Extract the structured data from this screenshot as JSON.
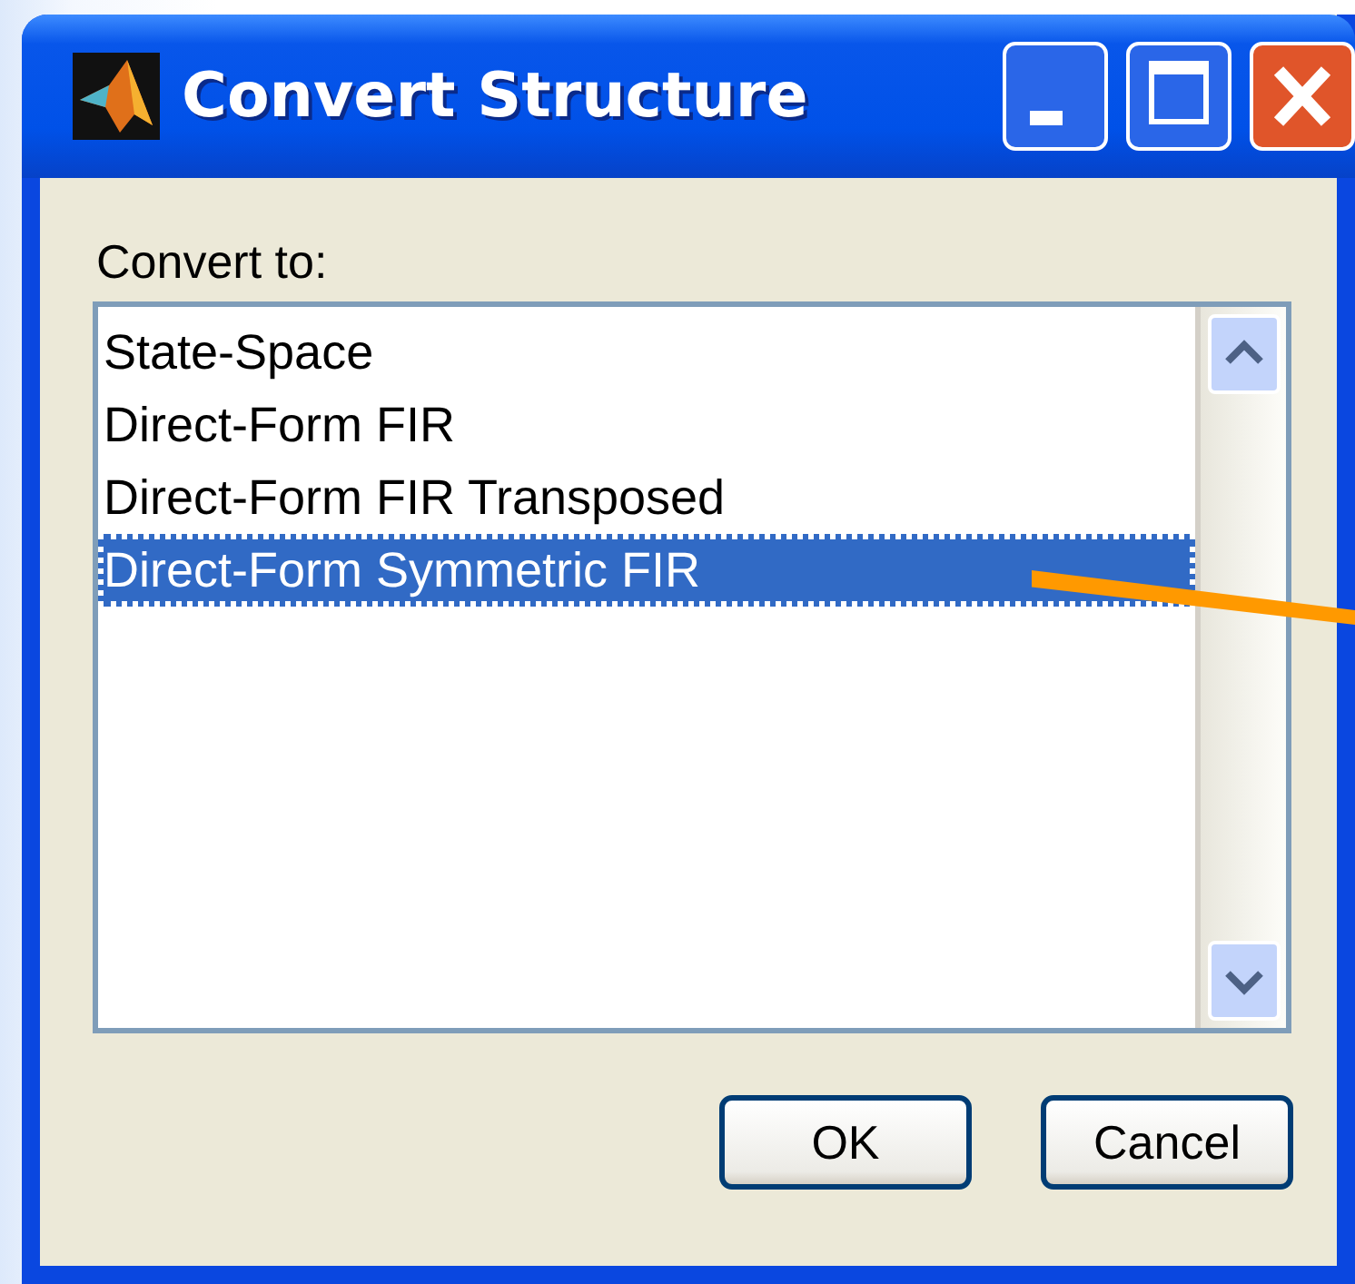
{
  "window": {
    "title": "Convert Structure"
  },
  "list": {
    "label": "Convert to:",
    "items": [
      {
        "label": "State-Space",
        "selected": false
      },
      {
        "label": "Direct-Form FIR",
        "selected": false
      },
      {
        "label": "Direct-Form FIR Transposed",
        "selected": false
      },
      {
        "label": "Direct-Form Symmetric FIR",
        "selected": true
      }
    ]
  },
  "buttons": [
    {
      "label": "OK"
    },
    {
      "label": "Cancel"
    }
  ]
}
